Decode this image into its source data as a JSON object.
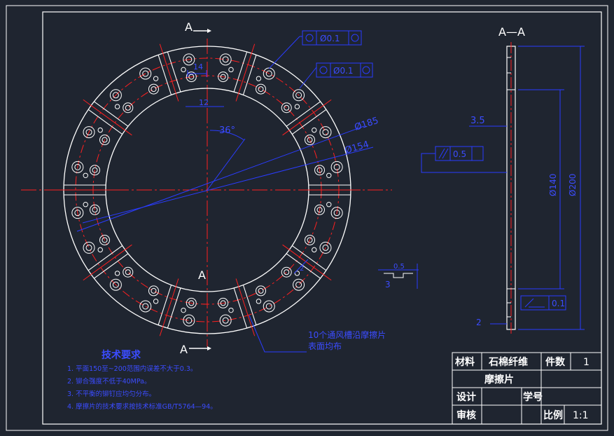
{
  "colors": {
    "background": "#1f2530",
    "outline": "#ffffff",
    "centerline": "#ff2020",
    "dimension": "#2a3cff"
  },
  "section_marks": {
    "top": "A",
    "middle": "A",
    "bottom": "A",
    "view_title": "A—A"
  },
  "dimensions": {
    "d_outer": "Ø185",
    "d_inner": "Ø154",
    "angle": "36°",
    "slot_width": "14",
    "slot_gap": "12",
    "tol_position_1": "Ø0.1",
    "tol_position_2": "Ø0.1",
    "tol_parallel": "0.5",
    "tol_flat": "0.1",
    "thickness": "3.5",
    "inner_dia_section": "Ø140",
    "outer_dia_section": "Ø200",
    "chamfer": "2",
    "detail_h": "0.5",
    "detail_w": "3",
    "vent_note_line1": "10个通风槽沿摩擦片",
    "vent_note_line2": "表面均布"
  },
  "tech_requirements": {
    "title": "技术要求",
    "items": [
      "1. 平面150至~200范围内误差不大于0.3。",
      "2. 铆合强度不低于40MPa。",
      "3. 不平衡的铆钉应均匀分布。",
      "4. 摩擦片的技术要求按技术标准GB/T5764—94。"
    ]
  },
  "title_block": {
    "material_label": "材料",
    "material_value": "石棉纤维",
    "count_label": "件数",
    "count_value": "1",
    "part_name": "摩擦片",
    "design_label": "设计",
    "student_id_label": "学号",
    "review_label": "审核",
    "scale_label": "比例",
    "scale_value": "1:1"
  }
}
